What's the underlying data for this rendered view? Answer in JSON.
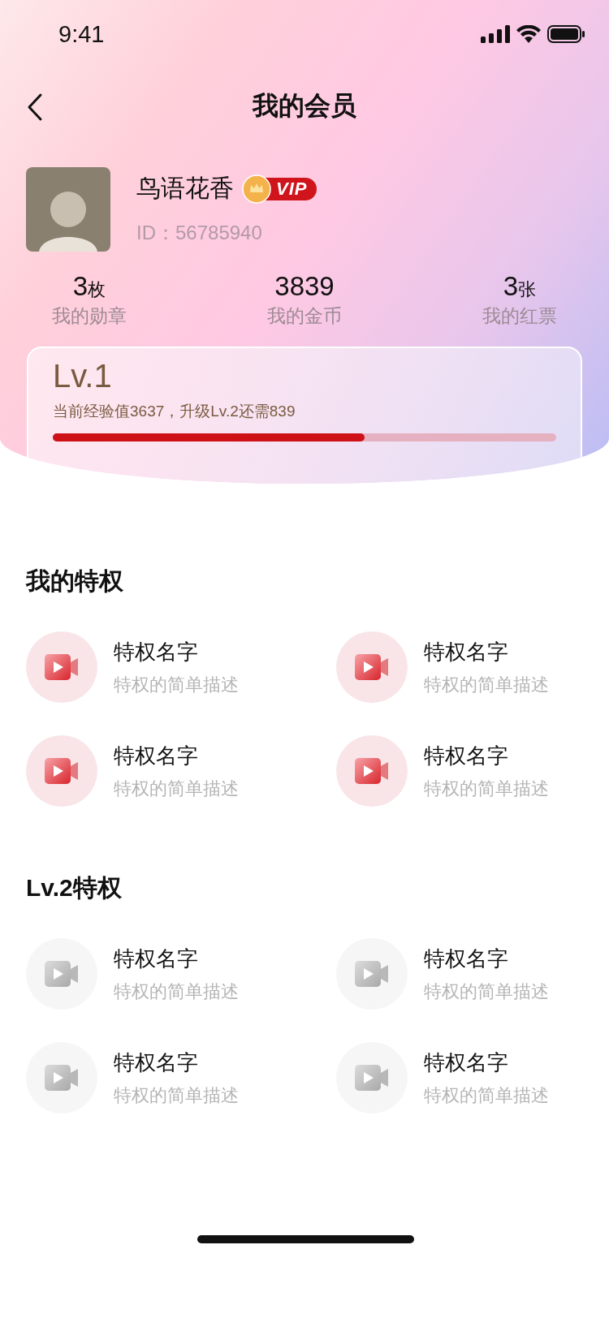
{
  "status_bar": {
    "time": "9:41"
  },
  "nav": {
    "title": "我的会员"
  },
  "profile": {
    "name": "鸟语花香",
    "vip_badge": "VIP",
    "id": "ID：56785940"
  },
  "stats": [
    {
      "value": "3",
      "unit": "枚",
      "label": "我的勋章"
    },
    {
      "value": "3839",
      "label": "我的金币"
    },
    {
      "value": "3",
      "unit": "张",
      "label": "我的红票"
    }
  ],
  "level_card": {
    "level_name": "Lv.1",
    "progress_text": "当前经验值3637，升级Lv.2还需839",
    "progress": {
      "level": 0.62
    }
  },
  "sections": [
    {
      "title": "我的特权",
      "unlocked": true,
      "items": [
        {
          "name": "特权名字",
          "description": "特权的简单描述"
        },
        {
          "name": "特权名字",
          "description": "特权的简单描述"
        },
        {
          "name": "特权名字",
          "description": "特权的简单描述"
        },
        {
          "name": "特权名字",
          "description": "特权的简单描述"
        }
      ]
    },
    {
      "title": "Lv.2特权",
      "unlocked": false,
      "items": [
        {
          "name": "特权名字",
          "description": "特权的简单描述"
        },
        {
          "name": "特权名字",
          "description": "特权的简单描述"
        },
        {
          "name": "特权名字",
          "description": "特权的简单描述"
        },
        {
          "name": "特权名字",
          "description": "特权的简单描述"
        }
      ]
    }
  ]
}
